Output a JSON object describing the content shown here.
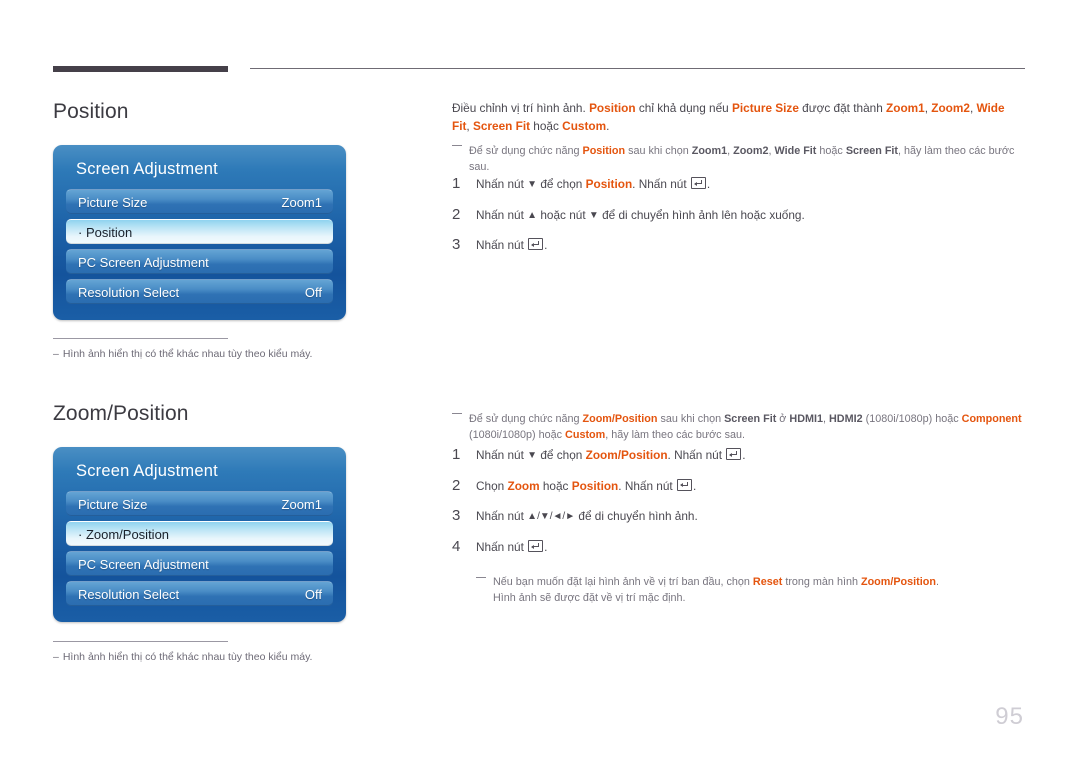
{
  "page": {
    "number": "95"
  },
  "sections": [
    {
      "heading": "Position",
      "osd": {
        "title": "Screen Adjustment",
        "rows": [
          {
            "label": "Picture Size",
            "value": "Zoom1",
            "selected": false
          },
          {
            "label": "· Position",
            "value": "",
            "selected": true
          },
          {
            "label": "PC Screen Adjustment",
            "value": "",
            "selected": false
          },
          {
            "label": "Resolution Select",
            "value": "Off",
            "selected": false
          }
        ]
      },
      "caption": {
        "dash": "‒",
        "text": "Hình ảnh hiển thị có thể khác nhau tùy theo kiểu máy."
      }
    },
    {
      "heading": "Zoom/Position",
      "osd": {
        "title": "Screen Adjustment",
        "rows": [
          {
            "label": "Picture Size",
            "value": "Zoom1",
            "selected": false
          },
          {
            "label": "· Zoom/Position",
            "value": "",
            "selected": true
          },
          {
            "label": "PC Screen Adjustment",
            "value": "",
            "selected": false
          },
          {
            "label": "Resolution Select",
            "value": "Off",
            "selected": false
          }
        ]
      },
      "caption": {
        "dash": "‒",
        "text": "Hình ảnh hiển thị có thể khác nhau tùy theo kiểu máy."
      }
    }
  ],
  "position_section": {
    "intro": {
      "p1": "Điều chỉnh vị trí hình ảnh. ",
      "hl_position": "Position",
      "p2": " chỉ khả dụng nếu ",
      "hl_picture_size": "Picture Size",
      "p3": " được đặt thành ",
      "hl_zoom1": "Zoom1",
      "sep1": ", ",
      "hl_zoom2": "Zoom2",
      "sep2": ", ",
      "hl_widefit": "Wide Fit",
      "sep3": ", ",
      "hl_screenfit": "Screen Fit",
      "p4": " hoặc ",
      "hl_custom": "Custom",
      "p5": "."
    },
    "note": {
      "n1": "Để sử dụng chức năng ",
      "hl_position": "Position",
      "n2": " sau khi chọn ",
      "bd_zoom1": "Zoom1",
      "s1": ", ",
      "bd_zoom2": "Zoom2",
      "s2": ", ",
      "bd_widefit": "Wide Fit",
      "n3": " hoặc ",
      "bd_screenfit": "Screen Fit",
      "n4": ", hãy làm theo các bước sau."
    },
    "steps": [
      {
        "num": "1",
        "t1": "Nhấn nút ",
        "arrow": "▼",
        "t2": " để chọn ",
        "hl": "Position",
        "t3": ". Nhấn nút ",
        "t4": "."
      },
      {
        "num": "2",
        "t1": "Nhấn nút ",
        "arrow": "▲",
        "t2": " hoặc nút ",
        "arrow2": "▼",
        "t3": " để di chuyển hình ảnh lên hoặc xuống."
      },
      {
        "num": "3",
        "t1": "Nhấn nút ",
        "t2": "."
      }
    ]
  },
  "zoomposition_section": {
    "note": {
      "n1": "Để sử dụng chức năng ",
      "hl_zoompos": "Zoom/Position",
      "n2": " sau khi chọn ",
      "bd_screenfit": "Screen Fit",
      "n3": " ở ",
      "bd_hdmi1": "HDMI1",
      "s1": ", ",
      "bd_hdmi2": "HDMI2",
      "n4": " (1080i/1080p) hoặc ",
      "hl_component": "Component",
      "n5": " (1080i/1080p) hoặc ",
      "hl_custom": "Custom",
      "n6": ", hãy làm theo các bước sau."
    },
    "steps": [
      {
        "num": "1",
        "t1": "Nhấn nút ",
        "arrow": "▼",
        "t2": " để chọn ",
        "hl": "Zoom/Position",
        "t3": ". Nhấn nút ",
        "t4": "."
      },
      {
        "num": "2",
        "t1": "Chọn ",
        "hl1": "Zoom",
        "t2": " hoặc ",
        "hl2": "Position",
        "t3": ". Nhấn nút ",
        "t4": "."
      },
      {
        "num": "3",
        "t1": "Nhấn nút ",
        "arrows": "▲/▼/◄/►",
        "t2": " để di chuyển hình ảnh."
      },
      {
        "num": "4",
        "t1": "Nhấn nút ",
        "t2": "."
      }
    ],
    "sub_note": {
      "n1": "Nếu bạn muốn đặt lại hình ảnh về vị trí ban đầu, chọn ",
      "hl_reset": "Reset",
      "n2": " trong màn hình ",
      "hl_zoompos": "Zoom/Position",
      "n3": ".",
      "n4": "Hình ảnh sẽ được đặt về vị trí mặc định."
    }
  }
}
